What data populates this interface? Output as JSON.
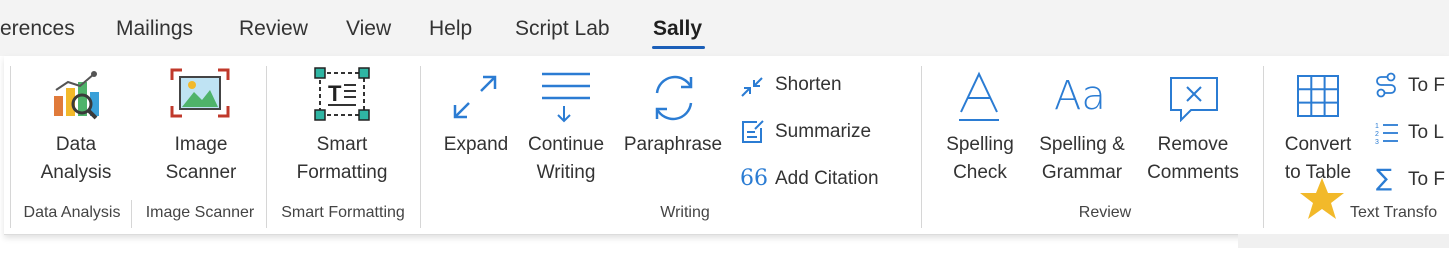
{
  "tabs": [
    "erences",
    "Mailings",
    "Review",
    "View",
    "Help",
    "Script Lab",
    "Sally"
  ],
  "active_tab": "Sally",
  "groups": {
    "data_analysis": {
      "button_line1": "Data",
      "button_line2": "Analysis",
      "group_label": "Data Analysis"
    },
    "image_scanner": {
      "button_line1": "Image",
      "button_line2": "Scanner",
      "group_label": "Image Scanner"
    },
    "smart_formatting": {
      "button_line1": "Smart",
      "button_line2": "Formatting",
      "group_label": "Smart Formatting"
    },
    "writing": {
      "expand": "Expand",
      "continue_line1": "Continue",
      "continue_line2": "Writing",
      "paraphrase": "Paraphrase",
      "shorten": "Shorten",
      "summarize": "Summarize",
      "add_citation": "Add Citation",
      "group_label": "Writing"
    },
    "review": {
      "spelling_line1": "Spelling",
      "spelling_line2": "Check",
      "grammar_line1": "Spelling &",
      "grammar_line2": "Grammar",
      "remove_line1": "Remove",
      "remove_line2": "Comments",
      "group_label": "Review"
    },
    "text_transform": {
      "convert_line1": "Convert",
      "convert_line2": "to Table",
      "to1": "To F",
      "to2": "To L",
      "to3": "To F",
      "group_label": "Text Transfo"
    }
  },
  "colors": {
    "accent": "#1b5fb8",
    "icon_blue": "#2b7cd3",
    "star": "#f2b92a"
  }
}
